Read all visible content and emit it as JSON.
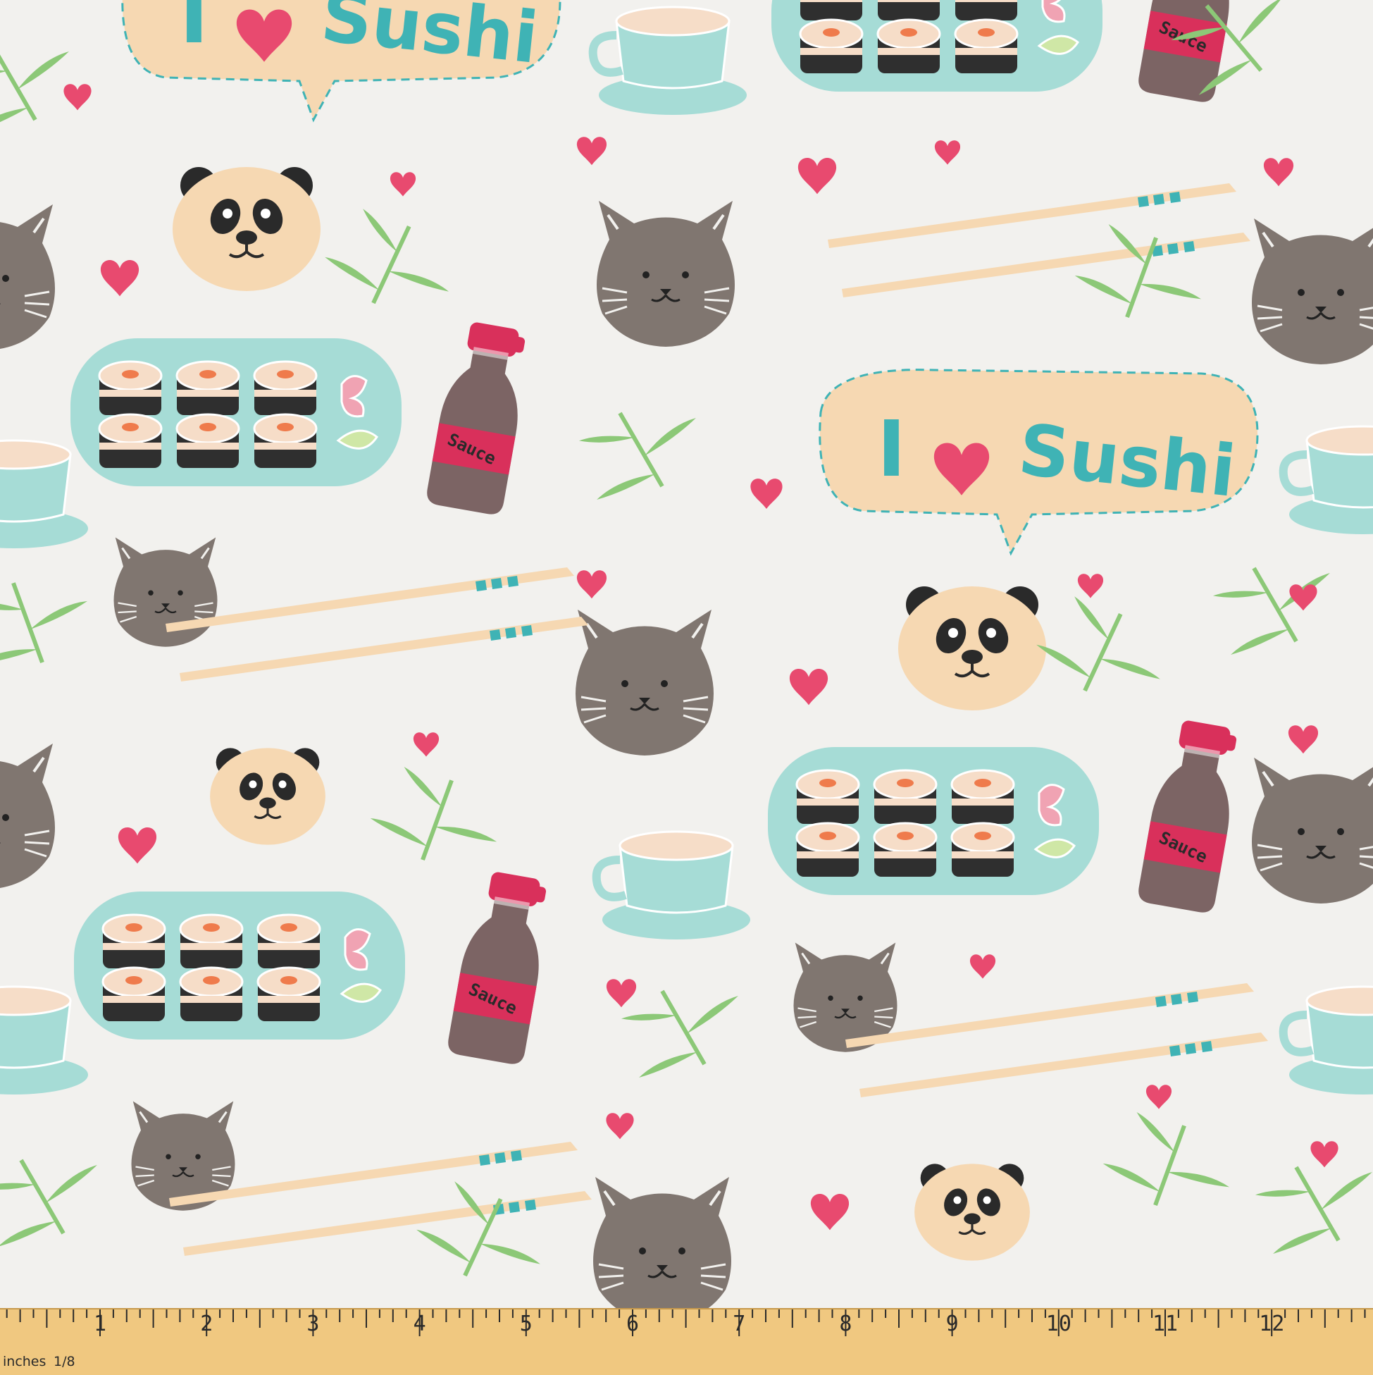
{
  "fabric": {
    "speech_bubble_text": "Sushi",
    "bottle_label": "Sauce",
    "colors": {
      "background": "#f2f1ee",
      "peach": "#f6d8b2",
      "teal": "#a6dcd6",
      "teal_text": "#3fb3b5",
      "cat_grey": "#807670",
      "heart_pink": "#e84a6f",
      "leaf_green": "#8cc877",
      "bottle_brown": "#7c6464",
      "bottle_red": "#d9305b",
      "nori": "#2f2f2f",
      "salmon": "#ef7b4c"
    },
    "motif_icons": [
      "speech-bubble-icon",
      "panda-face-icon",
      "cat-face-icon",
      "sushi-plate-icon",
      "sauce-bottle-icon",
      "chopsticks-icon",
      "tea-cup-icon",
      "heart-icon",
      "bamboo-leaf-icon"
    ]
  },
  "ruler": {
    "unit_label": "inches",
    "fraction_label": "1/8",
    "numbers": [
      "1",
      "2",
      "3",
      "4",
      "5",
      "6",
      "7",
      "8",
      "9",
      "10",
      "11",
      "12",
      "1"
    ]
  }
}
